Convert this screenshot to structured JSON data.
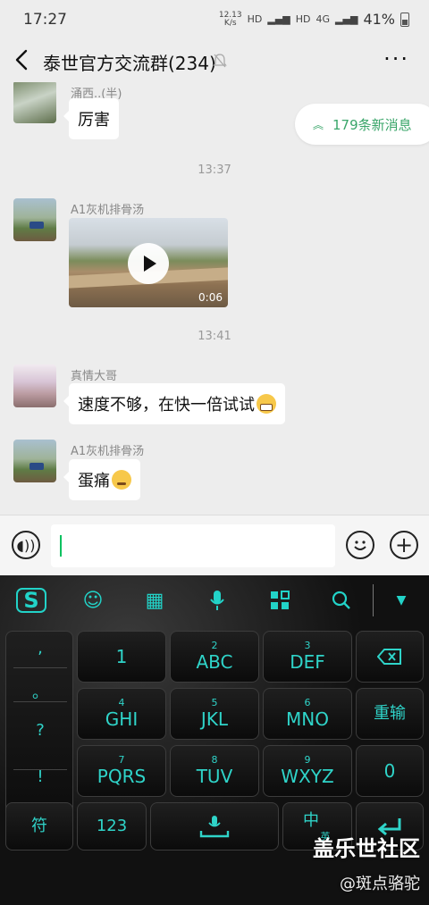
{
  "status_bar": {
    "time": "17:27",
    "speed_top": "12.13",
    "speed_unit": "K/s",
    "hd1": "HD",
    "hd2": "HD",
    "network": "4G",
    "battery": "41%"
  },
  "header": {
    "title": "泰世官方交流群(234)",
    "more": "···"
  },
  "messages": {
    "m1": {
      "sender": "涌西..(半)",
      "text": "厉害"
    },
    "ts1": "13:37",
    "m2": {
      "sender": "A1灰机排骨汤",
      "video_duration": "0:06"
    },
    "ts2": "13:41",
    "m3": {
      "sender": "真情大哥",
      "text": "速度不够，在快一倍试试"
    },
    "m4": {
      "sender": "A1灰机排骨汤",
      "text": "蛋痛"
    }
  },
  "new_messages": "179条新消息",
  "keyboard": {
    "punct": [
      ",",
      "。",
      "?",
      "!"
    ],
    "row1": [
      {
        "sub": "",
        "main": "1"
      },
      {
        "sub": "2",
        "main": "ABC"
      },
      {
        "sub": "3",
        "main": "DEF"
      }
    ],
    "row2": [
      {
        "sub": "4",
        "main": "GHI"
      },
      {
        "sub": "5",
        "main": "JKL"
      },
      {
        "sub": "6",
        "main": "MNO"
      }
    ],
    "row3": [
      {
        "sub": "7",
        "main": "PQRS"
      },
      {
        "sub": "8",
        "main": "TUV"
      },
      {
        "sub": "9",
        "main": "WXYZ"
      }
    ],
    "reenter": "重输",
    "zero": "0",
    "symbol": "符",
    "num123": "123",
    "zh": "中",
    "zh_sub": "英"
  },
  "watermark": {
    "line1": "盖乐世社区",
    "line2": "@斑点骆驼"
  },
  "colors": {
    "accent_green": "#3aa66a",
    "keyboard_teal": "#2fd4c9",
    "caret_green": "#07c160"
  }
}
